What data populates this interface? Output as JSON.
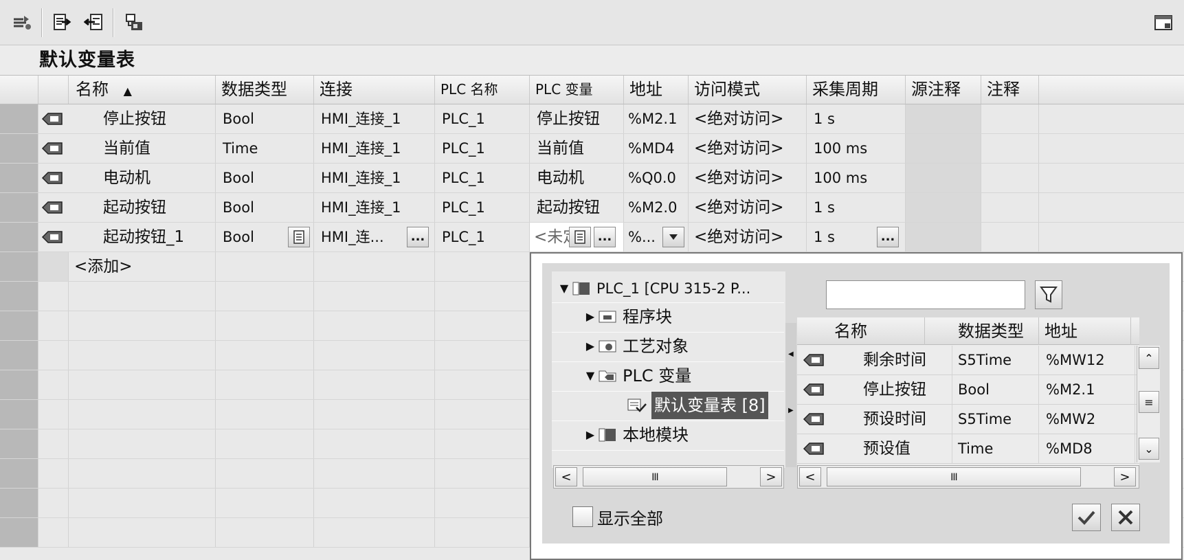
{
  "toolbar": {
    "buttons": [
      "add-rows-icon",
      "export-icon",
      "import-icon",
      "monitor-icon"
    ],
    "window_icon": "window-toggle-icon"
  },
  "table_title": "默认变量表",
  "columns": [
    "名称",
    "数据类型",
    "连接",
    "PLC 名称",
    "PLC 变量",
    "地址",
    "访问模式",
    "采集周期",
    "源注释",
    "注释"
  ],
  "sort_indicator": "▲",
  "rows": [
    {
      "name": "停止按钮",
      "type": "Bool",
      "connection": "HMI_连接_1",
      "plc_name": "PLC_1",
      "plc_var": "停止按钮",
      "address": "%M2.1",
      "access": "<绝对访问>",
      "cycle": "1 s"
    },
    {
      "name": "当前值",
      "type": "Time",
      "connection": "HMI_连接_1",
      "plc_name": "PLC_1",
      "plc_var": "当前值",
      "address": "%MD4",
      "access": "<绝对访问>",
      "cycle": "100 ms"
    },
    {
      "name": "电动机",
      "type": "Bool",
      "connection": "HMI_连接_1",
      "plc_name": "PLC_1",
      "plc_var": "电动机",
      "address": "%Q0.0",
      "access": "<绝对访问>",
      "cycle": "100 ms"
    },
    {
      "name": "起动按钮",
      "type": "Bool",
      "connection": "HMI_连接_1",
      "plc_name": "PLC_1",
      "plc_var": "起动按钮",
      "address": "%M2.0",
      "access": "<绝对访问>",
      "cycle": "1 s"
    }
  ],
  "edit_row": {
    "name": "起动按钮_1",
    "type": "Bool",
    "connection": "HMI_连...",
    "plc_name": "PLC_1",
    "plc_var": "<未定",
    "address": "%...",
    "access": "<绝对访问>",
    "cycle": "1 s",
    "ellipsis": "..."
  },
  "add_row": "<添加>",
  "popup": {
    "tree": [
      {
        "label": "PLC_1 [CPU 315-2 P...",
        "expand": "▼",
        "icon": "plc-device-icon"
      },
      {
        "label": "程序块",
        "expand": "▶",
        "icon": "program-blocks-icon"
      },
      {
        "label": "工艺对象",
        "expand": "▶",
        "icon": "technology-objects-icon"
      },
      {
        "label": "PLC 变量",
        "expand": "▼",
        "icon": "plc-tags-folder-icon"
      },
      {
        "label": "默认变量表 [8]",
        "expand": "",
        "icon": "tag-table-icon"
      },
      {
        "label": "本地模块",
        "expand": "▶",
        "icon": "local-modules-icon"
      }
    ],
    "search_value": "",
    "columns": [
      "名称",
      "数据类型",
      "地址"
    ],
    "rows": [
      {
        "name": "剩余时间",
        "type": "S5Time",
        "address": "%MW12"
      },
      {
        "name": "停止按钮",
        "type": "Bool",
        "address": "%M2.1"
      },
      {
        "name": "预设时间",
        "type": "S5Time",
        "address": "%MW2"
      },
      {
        "name": "预设值",
        "type": "Time",
        "address": "%MD8"
      }
    ],
    "show_all_label": "显示全部",
    "scroll_thumb": "III"
  }
}
